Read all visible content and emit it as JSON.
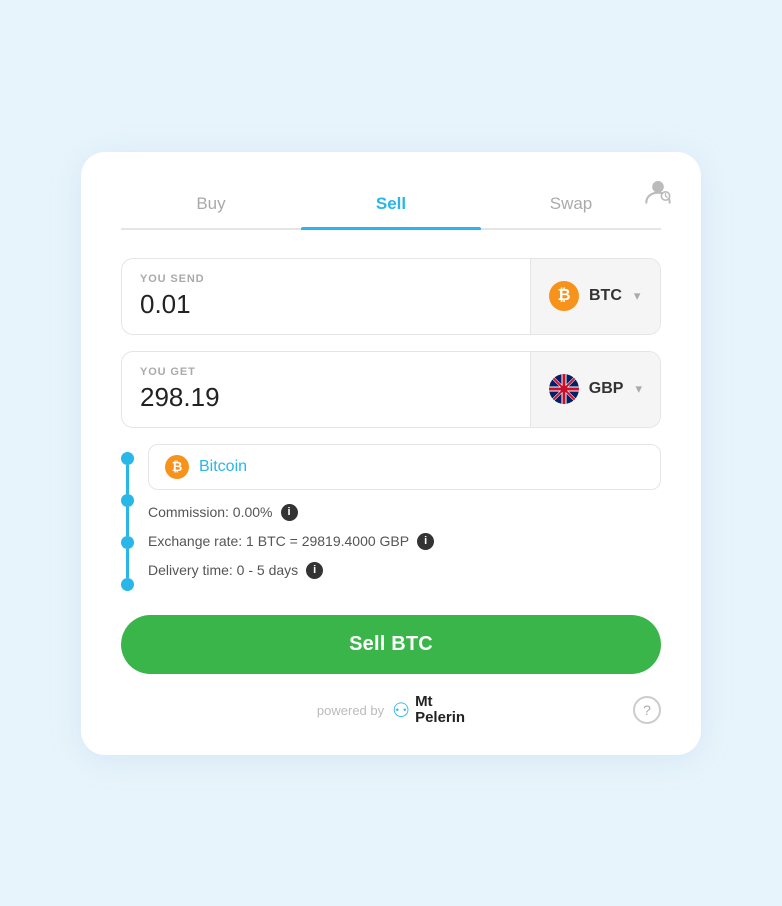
{
  "tabs": [
    {
      "id": "buy",
      "label": "Buy",
      "active": false
    },
    {
      "id": "sell",
      "label": "Sell",
      "active": true
    },
    {
      "id": "swap",
      "label": "Swap",
      "active": false
    }
  ],
  "you_send": {
    "label": "YOU SEND",
    "value": "0.01",
    "currency": "BTC",
    "currency_icon": "₿"
  },
  "you_get": {
    "label": "YOU GET",
    "value": "298.19",
    "currency": "GBP"
  },
  "bitcoin_dropdown": {
    "label": "Bitcoin"
  },
  "info": {
    "commission": "Commission: 0.00%",
    "exchange_rate": "Exchange rate: 1 BTC = 29819.4000 GBP",
    "delivery_time": "Delivery time: 0 - 5 days"
  },
  "sell_button": {
    "label": "Sell BTC"
  },
  "footer": {
    "powered_by": "powered by",
    "brand_line1": "Mt",
    "brand_line2": "Pelerin"
  },
  "icons": {
    "info": "i",
    "help": "?",
    "chevron": "▾"
  }
}
